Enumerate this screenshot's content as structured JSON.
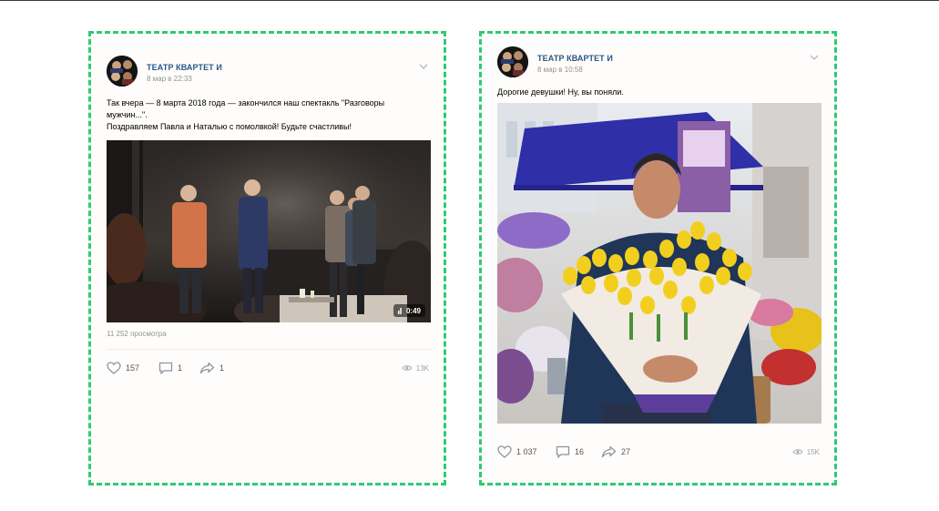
{
  "posts": [
    {
      "author": "ТЕАТР КВАРТЕТ И",
      "date": "8 мар в 22:33",
      "text_lines": [
        "Так вчера — 8 марта 2018 года — закончился наш спектакль \"Разговоры",
        "мужчин...\".",
        "Поздравляем Павла и Наталью с помолвкой! Будьте счастливы!"
      ],
      "video_duration": "0:49",
      "views_text": "11 252 просмотра",
      "likes": "157",
      "comments": "1",
      "shares": "1",
      "views_short": "13K"
    },
    {
      "author": "ТЕАТР КВАРТЕТ И",
      "date": "8 мар в 10:58",
      "text_lines": [
        "Дорогие девушки! Ну, вы поняли."
      ],
      "likes": "1 037",
      "comments": "16",
      "shares": "27",
      "views_short": "15K"
    }
  ],
  "colors": {
    "accent_dashed_border": "#2ecb71",
    "author_link": "#2a5885",
    "muted_text": "#939393"
  },
  "icons": [
    "avatar-image",
    "chevron-down-icon",
    "heart-icon",
    "comment-icon",
    "share-icon",
    "eye-icon",
    "video-duration-icon"
  ]
}
